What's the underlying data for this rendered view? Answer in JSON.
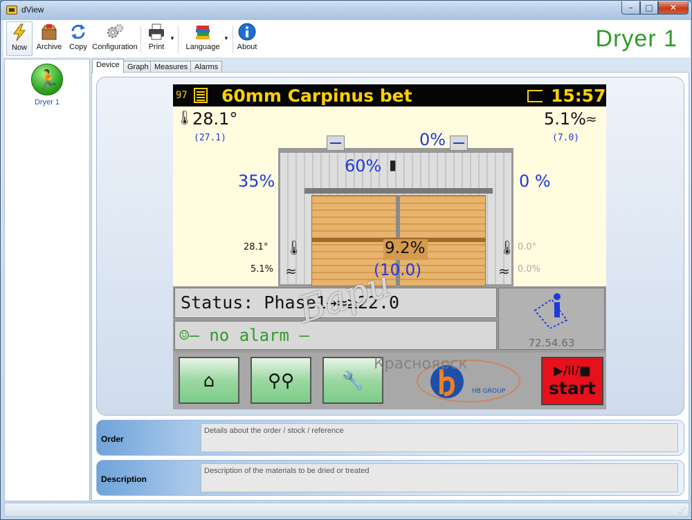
{
  "window": {
    "title": "dView"
  },
  "toolbar": {
    "now": "Now",
    "archive": "Archive",
    "copy": "Copy",
    "configuration": "Configuration",
    "print": "Print",
    "language": "Language",
    "about": "About"
  },
  "header": {
    "dryer_title": "Dryer 1"
  },
  "sidebar": {
    "items": [
      {
        "label": "Dryer 1"
      }
    ]
  },
  "tabs": [
    {
      "label": "Device"
    },
    {
      "label": "Graph"
    },
    {
      "label": "Measures"
    },
    {
      "label": "Alarms"
    }
  ],
  "screen": {
    "program_number": "97",
    "program_name": "60mm Carpinus bet",
    "time": "15:57",
    "temp": "28.1°",
    "temp_set": "(27.1)",
    "humidity": "5.1%",
    "humidity_set": "(7.0)",
    "top_flap": "0%",
    "fan": "60%",
    "spray": "35%",
    "exhaust": "0 %",
    "left_temp": "28.1°",
    "left_hum": "5.1%",
    "right_temp": "0.0°",
    "right_hum": "0.0%",
    "wood_moisture": "9.2%",
    "wood_moisture_set": "(10.0)",
    "status": "Status: Phase1→≈≥22.0",
    "alarm": "☺– no alarm –",
    "version": "72.54.63",
    "start_symbols": "▶/II/■",
    "start_label": "start",
    "logo_text": "HB GROUP"
  },
  "watermark": {
    "text": "Бари",
    "city": "Красноярск"
  },
  "order": {
    "label": "Order",
    "placeholder": "Details about the order / stock / reference"
  },
  "description": {
    "label": "Description",
    "placeholder": "Description of the materials to be dried or treated"
  },
  "colors": {
    "accent_green": "#2f9a2a",
    "screen_yellow": "#ffd000",
    "screen_blue": "#1d3bd9",
    "start_red": "#e8101a"
  }
}
